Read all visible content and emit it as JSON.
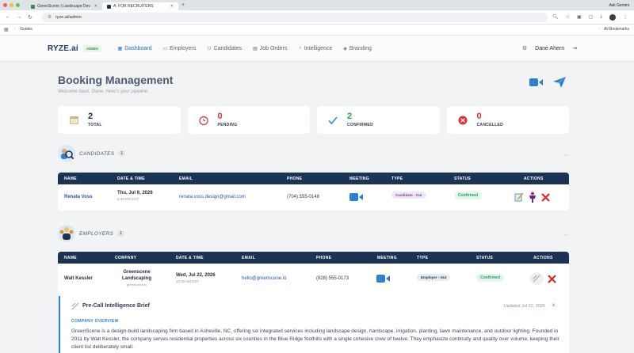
{
  "browser": {
    "tabs": [
      {
        "label": "GreenScene | Landscape Dev",
        "active": false
      },
      {
        "label": "A: FOR RECRUITERS",
        "active": true
      }
    ],
    "new_tab": "+",
    "ask": "Ask Gemini",
    "url": "ryze.ai/admin",
    "bookmark": "Guides",
    "all_bookmarks": "All Bookmarks"
  },
  "app": {
    "logo": "RYZE.ai",
    "badge": "ADMIN",
    "nav": [
      {
        "label": "Dashboard",
        "icon": "grid-icon",
        "active": true
      },
      {
        "label": "Employers",
        "icon": "briefcase-icon",
        "active": false
      },
      {
        "label": "Candidates",
        "icon": "people-icon",
        "active": false
      },
      {
        "label": "Job Orders",
        "icon": "clipboard-icon",
        "active": false
      },
      {
        "label": "Intelligence",
        "icon": "bulb-icon",
        "active": false
      },
      {
        "label": "Branding",
        "icon": "tag-icon",
        "active": false
      }
    ],
    "user": "Dane Ahern"
  },
  "page": {
    "title": "Booking Management",
    "subtitle": "Welcome back, Dane. Here's your pipeline."
  },
  "stats": [
    {
      "value": "2",
      "label": "TOTAL",
      "icon": "calendar-icon"
    },
    {
      "value": "0",
      "label": "PENDING",
      "icon": "clock-icon"
    },
    {
      "value": "2",
      "label": "CONFIRMED",
      "icon": "check-icon"
    },
    {
      "value": "0",
      "label": "CANCELLED",
      "icon": "x-circle-icon"
    }
  ],
  "candidates": {
    "title": "CANDIDATES",
    "count": "1",
    "headers": [
      "NAME",
      "DATE & TIME",
      "EMAIL",
      "PHONE",
      "MEETING",
      "TYPE",
      "STATUS",
      "ACTIONS"
    ],
    "rows": [
      {
        "name": "Renata Voss",
        "date": "Thu, Jul 9, 2026",
        "time": "6:30 PM EST",
        "email": "renata.voss.design@gmail.com",
        "phone": "(704) 555-0148",
        "type": "Candidate - Out",
        "status": "Confirmed"
      }
    ]
  },
  "employers": {
    "title": "EMPLOYERS",
    "count": "1",
    "headers": [
      "NAME",
      "COMPANY",
      "DATE & TIME",
      "EMAIL",
      "PHONE",
      "MEETING",
      "TYPE",
      "STATUS",
      "ACTIONS"
    ],
    "rows": [
      {
        "name": "Walt Kessler",
        "company": "Greenscene Landscaping",
        "company_url": "greenscene.io",
        "date": "Wed, Jul 22, 2026",
        "time": "10:30 AM EST",
        "email": "hello@greenscene.io",
        "phone": "(828) 555-0173",
        "type": "Employer - Out",
        "status": "Confirmed"
      }
    ]
  },
  "brief": {
    "title": "Pre-Call Intelligence Brief",
    "updated": "Updated Jul 22, 2026",
    "close": "x",
    "section": "COMPANY OVERVIEW",
    "text": "GreenScene is a design-build landscaping firm based in Asheville, NC, offering six integrated services including landscape design, hardscape, irrigation, planting, lawn maintenance, and outdoor lighting. Founded in 2011 by Walt Kessler, the company serves residential properties across six counties in the Blue Ridge foothills with a single cohesive crew of twelve. They emphasize continuity and quality over volume, keeping their client list deliberately small."
  },
  "colors": {
    "navy": "#1b3456",
    "confirmed_green": "#22a35b",
    "danger_red": "#d33",
    "link_blue": "#2756a8"
  }
}
